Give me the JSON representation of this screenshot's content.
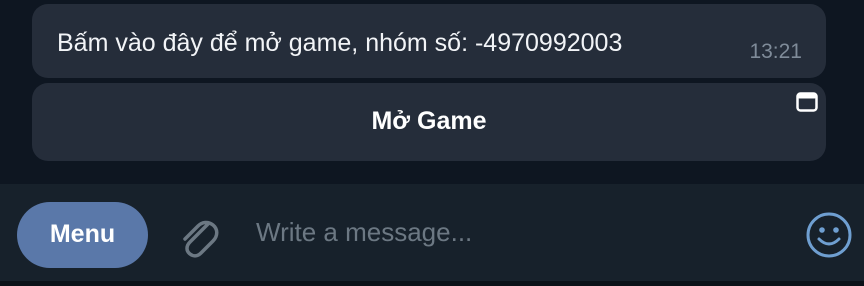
{
  "message": {
    "text": "Bấm vào đây để mở game, nhóm số: -4970992003",
    "time": "13:21"
  },
  "inline_keyboard": {
    "button_label": "Mở Game",
    "icon": "webapp-window-icon"
  },
  "composer": {
    "menu_label": "Menu",
    "placeholder": "Write a message...",
    "attach_icon": "paperclip-icon",
    "emoji_icon": "smiley-icon"
  },
  "colors": {
    "background": "#0e1621",
    "bubble": "#252d3a",
    "composer": "#17212b",
    "menu_button": "#5a78a9",
    "accent": "#6f9fd1"
  }
}
